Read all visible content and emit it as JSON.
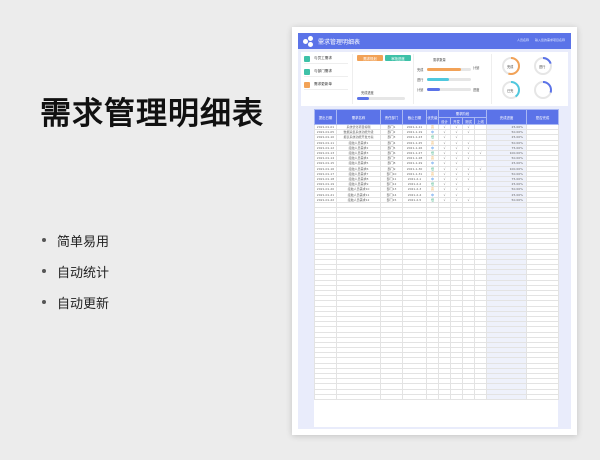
{
  "hero": {
    "title": "需求管理明细表",
    "bullets": [
      "简单易用",
      "自动统计",
      "自动更新"
    ]
  },
  "sheet": {
    "app_title": "需求管理明细表",
    "top_right": [
      "人员名称",
      "输入您的需求项目名称"
    ],
    "nav": [
      {
        "label": "与员工需求",
        "icon_color": "#3ec1a8"
      },
      {
        "label": "与部门需求",
        "icon_color": "#3ec1a8"
      },
      {
        "label": "需求更新单",
        "icon_color": "#f2a257"
      }
    ],
    "buttons": [
      {
        "label": "需求规划",
        "color": "#f2a257"
      },
      {
        "label": "审批进度",
        "color": "#3ec1a8"
      }
    ],
    "left_progress": {
      "label": "完成进度",
      "value": 0.25
    },
    "bars_title": "需求数量",
    "bars": [
      {
        "label": "完成",
        "value": 0.78,
        "color": "#f2a257"
      },
      {
        "label": "进行",
        "value": 0.5,
        "color": "#4fc8de"
      },
      {
        "label": "计划",
        "value": 0.3,
        "color": "#5b73e8"
      }
    ],
    "mid_labels": [
      "计划",
      "进度"
    ],
    "donuts": [
      {
        "label": "完成",
        "value": 0.55,
        "color": "#f2a257"
      },
      {
        "label": "进行",
        "value": 0.2,
        "color": "#5b73e8"
      },
      {
        "label": "已完",
        "value": 0.4,
        "color": "#4fc8de"
      },
      {
        "label": "",
        "value": 0.3,
        "color": "#5b73e8"
      }
    ],
    "table": {
      "headers": [
        "提出日期",
        "需求名称",
        "责任部门",
        "截止日期",
        "优先级",
        "需求阶段",
        "完成进度",
        "是否完成"
      ],
      "stage_sub": [
        "设计",
        "开发",
        "测试",
        "上线"
      ],
      "rows": [
        {
          "date": "2021-01-01",
          "name": "系统优化项目编辑",
          "dept": "部门1",
          "due": "2021-1-11",
          "pri": "高",
          "pri_c": "o",
          "s": [
            "√",
            "√",
            "√",
            ""
          ],
          "prog": "25.00%"
        },
        {
          "date": "2021-01-05",
          "name": "数据采集系统功能升级",
          "dept": "部门2",
          "due": "2021-1-19",
          "pri": "中",
          "pri_c": "",
          "s": [
            "√",
            "√",
            "√",
            ""
          ],
          "prog": "50.00%"
        },
        {
          "date": "2021-01-10",
          "name": "报表系统功能开发方案",
          "dept": "部门3",
          "due": "2021-1-23",
          "pri": "低",
          "pri_c": "g",
          "s": [
            "√",
            "√",
            "",
            ""
          ],
          "prog": "25.00%"
        },
        {
          "date": "2021-01-11",
          "name": "接触人员需求1",
          "dept": "部门4",
          "due": "2021-1-25",
          "pri": "高",
          "pri_c": "o",
          "s": [
            "√",
            "√",
            "√",
            ""
          ],
          "prog": "50.00%"
        },
        {
          "date": "2021-01-12",
          "name": "接触人员需求2",
          "dept": "部门5",
          "due": "2021-1-26",
          "pri": "中",
          "pri_c": "",
          "s": [
            "√",
            "√",
            "√",
            ""
          ],
          "prog": "75.00%"
        },
        {
          "date": "2021-01-13",
          "name": "接触人员需求3",
          "dept": "部门6",
          "due": "2021-1-27",
          "pri": "低",
          "pri_c": "g",
          "s": [
            "√",
            "√",
            "√",
            "√"
          ],
          "prog": "100.00%"
        },
        {
          "date": "2021-01-14",
          "name": "接触人员需求4",
          "dept": "部门7",
          "due": "2021-1-28",
          "pri": "高",
          "pri_c": "o",
          "s": [
            "√",
            "√",
            "√",
            ""
          ],
          "prog": "50.00%"
        },
        {
          "date": "2021-01-15",
          "name": "接触人员需求5",
          "dept": "部门8",
          "due": "2021-1-29",
          "pri": "中",
          "pri_c": "",
          "s": [
            "√",
            "√",
            "",
            ""
          ],
          "prog": "25.00%"
        },
        {
          "date": "2021-01-16",
          "name": "接触人员需求6",
          "dept": "部门9",
          "due": "2021-1-30",
          "pri": "低",
          "pri_c": "g",
          "s": [
            "√",
            "√",
            "√",
            "√"
          ],
          "prog": "100.00%"
        },
        {
          "date": "2021-01-17",
          "name": "接触人员需求7",
          "dept": "部门10",
          "due": "2021-1-31",
          "pri": "高",
          "pri_c": "o",
          "s": [
            "√",
            "√",
            "√",
            ""
          ],
          "prog": "50.00%"
        },
        {
          "date": "2021-01-18",
          "name": "接触人员需求8",
          "dept": "部门11",
          "due": "2021-2-1",
          "pri": "中",
          "pri_c": "",
          "s": [
            "√",
            "√",
            "√",
            ""
          ],
          "prog": "75.00%"
        },
        {
          "date": "2021-01-19",
          "name": "接触人员需求9",
          "dept": "部门12",
          "due": "2021-2-2",
          "pri": "低",
          "pri_c": "g",
          "s": [
            "√",
            "√",
            "",
            ""
          ],
          "prog": "25.00%"
        },
        {
          "date": "2021-01-20",
          "name": "接触人员需求10",
          "dept": "部门13",
          "due": "2021-2-3",
          "pri": "高",
          "pri_c": "o",
          "s": [
            "√",
            "√",
            "√",
            ""
          ],
          "prog": "50.00%"
        },
        {
          "date": "2021-01-21",
          "name": "接触人员需求11",
          "dept": "部门14",
          "due": "2021-2-4",
          "pri": "中",
          "pri_c": "",
          "s": [
            "√",
            "√",
            "",
            ""
          ],
          "prog": "25.00%"
        },
        {
          "date": "2021-01-22",
          "name": "接触人员需求12",
          "dept": "部门15",
          "due": "2021-2-5",
          "pri": "低",
          "pri_c": "g",
          "s": [
            "√",
            "√",
            "√",
            ""
          ],
          "prog": "50.00%"
        }
      ],
      "empty_rows": 38
    }
  }
}
